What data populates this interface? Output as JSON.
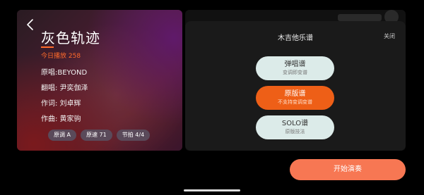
{
  "song": {
    "title": "灰色轨迹",
    "plays_label": "今日播放",
    "plays_count": "258",
    "original_singer": "原唱:BEYOND",
    "cover_singer": "翻唱: 尹奕伽泽",
    "lyricist": "作词: 刘卓辉",
    "composer": "作曲: 黄家驹",
    "tags": [
      "原调 A",
      "原速 71",
      "节拍 4/4"
    ]
  },
  "modal": {
    "title": "木吉他乐谱",
    "close_label": "关闭",
    "options": [
      {
        "title": "弹唱谱",
        "subtitle": "变调即变谱"
      },
      {
        "title": "原版谱",
        "subtitle": "不支持变调变谱"
      },
      {
        "title": "SOLO谱",
        "subtitle": "原版技法"
      }
    ]
  },
  "footer": {
    "start_label": "开始演奏"
  },
  "icons": {
    "back": "chevron-left-icon"
  },
  "colors": {
    "accent": "#ff6a2b",
    "selected_option": "#ee5f17",
    "start_button": "#f77753"
  }
}
